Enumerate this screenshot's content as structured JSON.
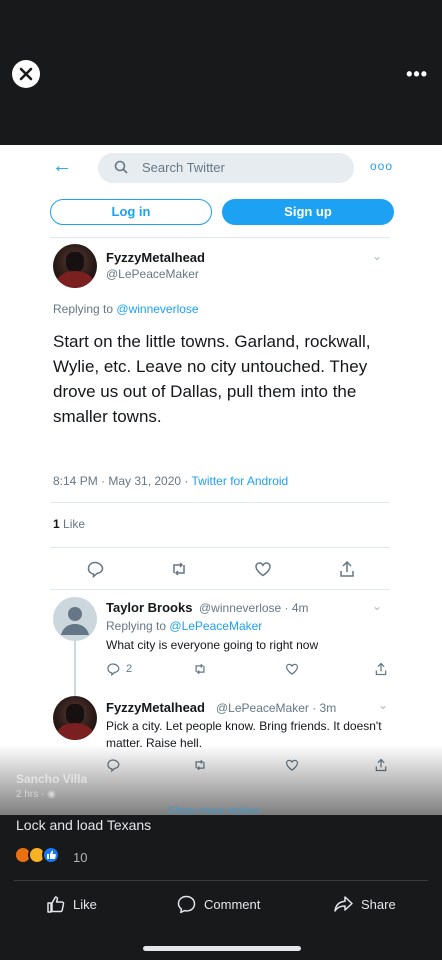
{
  "viewer": {
    "close_icon": "close-icon",
    "more_label": "•••"
  },
  "twitter": {
    "search_placeholder": "Search Twitter",
    "login_label": "Log in",
    "signup_label": "Sign up",
    "more_label": "ooo",
    "accent": "#1da1f2",
    "main_tweet": {
      "name": "FyzzyMetalhead",
      "handle": "@LePeaceMaker",
      "replying_prefix": "Replying to",
      "replying_to": "@winneverlose",
      "text": "Start on the little towns. Garland, rockwall, Wylie, etc. Leave no city untouched. They drove us out of Dallas, pull them into the smaller towns.",
      "time": "8:14 PM · May 31, 2020 · ",
      "source": "Twitter for Android",
      "likes_count": "1",
      "likes_label": "Like"
    },
    "replies": [
      {
        "name": "Taylor Brooks",
        "handle_time": "@winneverlose · 4m",
        "replying_prefix": "Replying to",
        "replying_to": "@LePeaceMaker",
        "text": "What city is everyone going to right now",
        "reply_count": "2"
      },
      {
        "name": "FyzzyMetalhead",
        "handle_time": "@LePeaceMaker · 3m",
        "text": "Pick a city. Let people know. Bring friends. It doesn't matter. Raise hell."
      }
    ],
    "show_more": "Show more replies"
  },
  "post": {
    "author": "Sancho Villa",
    "sub": "2 hrs · ",
    "caption": "Lock and load Texans",
    "reaction_count": "10",
    "actions": {
      "like": "Like",
      "comment": "Comment",
      "share": "Share"
    }
  }
}
